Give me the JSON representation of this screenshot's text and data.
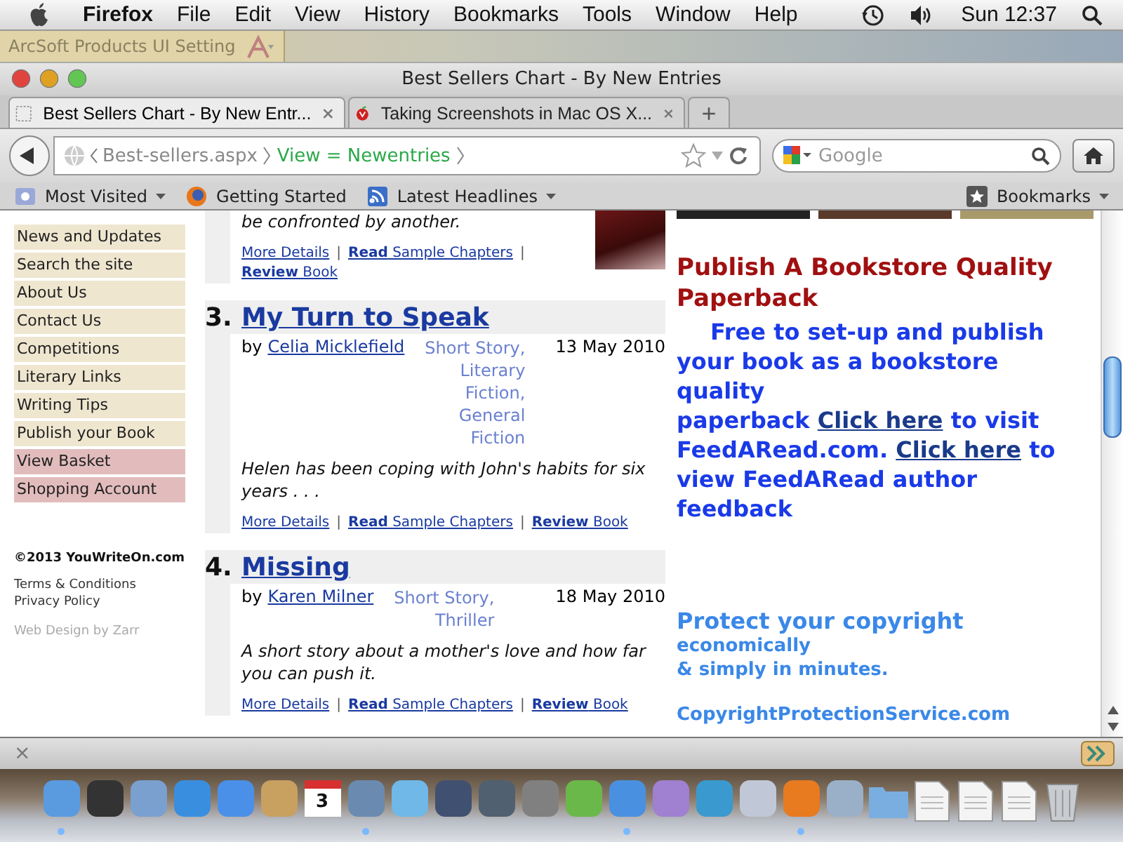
{
  "menu_bar": {
    "app": "Firefox",
    "menus": [
      "File",
      "Edit",
      "View",
      "History",
      "Bookmarks",
      "Tools",
      "Window",
      "Help"
    ],
    "clock": "Sun 12:37"
  },
  "desktop_bar": {
    "label": "ArcSoft Products UI Setting"
  },
  "window": {
    "title": "Best Sellers Chart - By New Entries"
  },
  "tabs": [
    {
      "label": "Best Sellers Chart - By New Entr...",
      "selected": true
    },
    {
      "label": "Taking Screenshots in Mac OS X...",
      "selected": false
    }
  ],
  "new_tab": "+",
  "address_bar": {
    "segments": [
      {
        "text": "Best-sellers.aspx",
        "kind": "page"
      },
      {
        "text": "View = Newentries",
        "kind": "param"
      }
    ]
  },
  "search": {
    "placeholder": "Google"
  },
  "bookmarks_bar": {
    "items": [
      {
        "label": "Most Visited",
        "menu": true
      },
      {
        "label": "Getting Started",
        "menu": false
      },
      {
        "label": "Latest Headlines",
        "menu": true
      }
    ],
    "right": "Bookmarks"
  },
  "sidebar": {
    "items": [
      {
        "label": "News and Updates",
        "color": "#efe6d0"
      },
      {
        "label": "Search the site",
        "color": "#efe6d0"
      },
      {
        "label": "About Us",
        "color": "#efe6d0"
      },
      {
        "label": "Contact Us",
        "color": "#efe6d0"
      },
      {
        "label": "Competitions",
        "color": "#efe6d0"
      },
      {
        "label": "Literary Links",
        "color": "#efe6d0"
      },
      {
        "label": "Writing Tips",
        "color": "#efe6d0"
      },
      {
        "label": "Publish your Book",
        "color": "#efe6d0"
      },
      {
        "label": "View Basket",
        "color": "#e2bcbc"
      },
      {
        "label": "Shopping Account",
        "color": "#e2bcbc"
      }
    ],
    "copyright": "©2013 YouWriteOn.com",
    "links": [
      "Terms & Conditions",
      "Privacy Policy"
    ],
    "credit": "Web Design by Zarr"
  },
  "entries": [
    {
      "description": "be confronted by another.",
      "cover": true,
      "links": [
        {
          "text": "More Details",
          "kind": "link"
        },
        {
          "text": "|",
          "kind": "separator"
        },
        {
          "text": "**Read** Sample Chapters",
          "kind": "link"
        },
        {
          "text": "|",
          "kind": "separator"
        },
        {
          "text": "**Review** Book",
          "kind": "link"
        }
      ]
    },
    {
      "number": "3.",
      "title": "My Turn to Speak",
      "author": "Celia Micklefield",
      "author_prefix": "by",
      "genres": "Short Story, Literary Fiction, General Fiction",
      "date": "13 May 2010",
      "description": "Helen has been coping with John's habits for six years . . .",
      "cover": false,
      "links": [
        {
          "text": "More Details",
          "kind": "link"
        },
        {
          "text": "|",
          "kind": "separator"
        },
        {
          "text": "**Read** Sample Chapters",
          "kind": "link"
        },
        {
          "text": "|",
          "kind": "separator"
        },
        {
          "text": "**Review** Book",
          "kind": "link"
        }
      ]
    },
    {
      "number": "4.",
      "title": "Missing",
      "author": "Karen Milner",
      "author_prefix": "by",
      "genres": "Short Story, Thriller",
      "date": "18 May 2010",
      "description": "A short story about a mother's love and how far you can push it.",
      "cover": false,
      "links": [
        {
          "text": "More Details",
          "kind": "link"
        },
        {
          "text": "|",
          "kind": "separator"
        },
        {
          "text": "**Read** Sample Chapters",
          "kind": "link"
        },
        {
          "text": "|",
          "kind": "separator"
        },
        {
          "text": "**Review** Book",
          "kind": "link"
        }
      ]
    }
  ],
  "right_column": {
    "ad_heading": "Publish A Bookstore Quality Paperback",
    "ad_parts": [
      {
        "text": "Free to set-up and publish your book as a bookstore quality",
        "kind": "text"
      },
      {
        "kind": "break"
      },
      {
        "text": "paperback",
        "kind": "text"
      },
      {
        "text": "Click here",
        "kind": "link"
      },
      {
        "text": "to visit FeedARead.com.",
        "kind": "text"
      },
      {
        "text": "Click here",
        "kind": "link"
      },
      {
        "text": "to view FeedARead author feedback",
        "kind": "text"
      }
    ],
    "copyright_heading": "Protect your copyright",
    "copyright_lines": [
      "economically",
      "& simply in minutes."
    ],
    "copyright_link": "CopyrightProtectionService.com"
  },
  "status_bar": {
    "close": "×"
  },
  "dock": [
    {
      "kind": "app",
      "color": "#5a9be0",
      "running": true
    },
    {
      "kind": "app",
      "color": "#333333",
      "running": false
    },
    {
      "kind": "app",
      "color": "#7aa0d0",
      "running": false
    },
    {
      "kind": "app",
      "color": "#3a8ee0",
      "running": false
    },
    {
      "kind": "app",
      "color": "#4a90e8",
      "running": false
    },
    {
      "kind": "app",
      "color": "#c8a060",
      "running": false
    },
    {
      "kind": "calendar",
      "label": "3",
      "running": false
    },
    {
      "kind": "app",
      "color": "#6a8ab0",
      "running": true
    },
    {
      "kind": "app",
      "color": "#70b8e8",
      "running": false
    },
    {
      "kind": "app",
      "color": "#405070",
      "running": false
    },
    {
      "kind": "app",
      "color": "#506070",
      "running": false
    },
    {
      "kind": "app",
      "color": "#808080",
      "running": false
    },
    {
      "kind": "app",
      "color": "#6ab84a",
      "running": false
    },
    {
      "kind": "app",
      "color": "#4a90e0",
      "running": true
    },
    {
      "kind": "app",
      "color": "#a080d0",
      "running": false
    },
    {
      "kind": "app",
      "color": "#3a9ad0",
      "running": false
    },
    {
      "kind": "app",
      "color": "#c0c8d8",
      "running": false
    },
    {
      "kind": "app",
      "color": "#e87a20",
      "running": true
    },
    {
      "kind": "app",
      "color": "#9ab0c8",
      "running": false
    },
    {
      "kind": "folder",
      "running": false
    },
    {
      "kind": "document",
      "running": false
    },
    {
      "kind": "document",
      "running": false
    },
    {
      "kind": "document",
      "running": false
    },
    {
      "kind": "trash",
      "running": false
    }
  ]
}
